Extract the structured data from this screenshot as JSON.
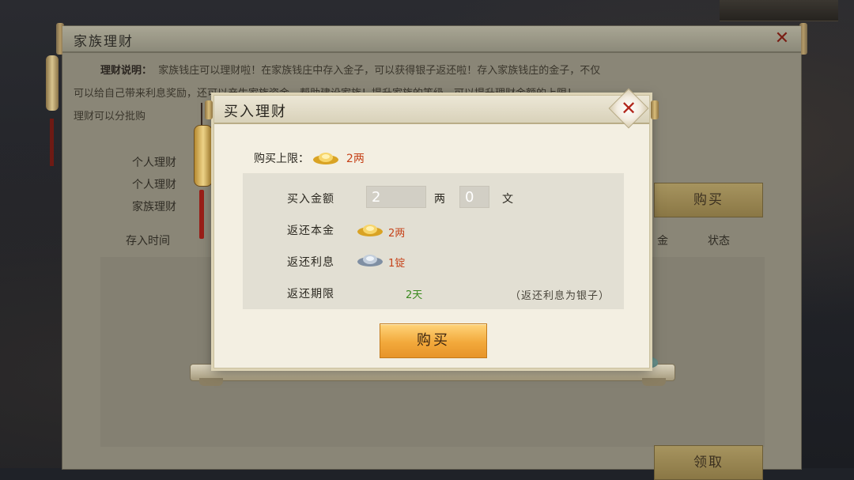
{
  "outer": {
    "title": "家族理财",
    "desc_label": "理财说明：",
    "desc_line1": "家族钱庄可以理财啦！在家族钱庄中存入金子，可以获得银子返还啦！存入家族钱庄的金子，不仅",
    "desc_line2": "可以给自己带来利息奖励，还可以产生家族资金，帮助建设家族！提升家族的等级，可以提升理财金额的上限！",
    "desc_line3": "理财可以分批购",
    "info1": "个人理财",
    "info2": "个人理财",
    "info3": "家族理财",
    "col_time": "存入时间",
    "col_gold": "金",
    "col_status": "状态",
    "buy_label": "购买",
    "claim_label": "领取"
  },
  "modal": {
    "title": "买入理财",
    "limit_label": "购买上限：",
    "limit_value": "2两",
    "amount_label": "买入金额",
    "amount_liang": "2",
    "unit_liang": "两",
    "amount_wen": "0",
    "unit_wen": "文",
    "principal_label": "返还本金",
    "principal_value": "2两",
    "interest_label": "返还利息",
    "interest_value": "1锭",
    "term_label": "返还期限",
    "term_value": "2天",
    "note": "（返还利息为银子）",
    "buy_label": "购买"
  },
  "icons": {
    "gold": "gold-ingot-icon",
    "silver": "silver-ingot-icon",
    "close": "close-icon"
  },
  "colors": {
    "orange_value": "#c6431a",
    "green_value": "#3a8a1f",
    "buy_button": "#f2a93b"
  }
}
